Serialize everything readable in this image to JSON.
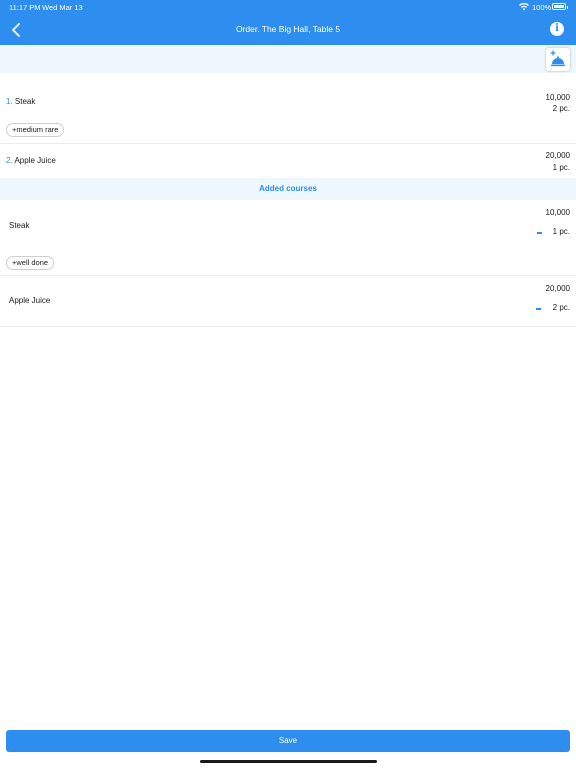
{
  "status_bar": {
    "time": "11:17 PM",
    "date": "Wed Mar 13",
    "battery_percent": "100%"
  },
  "header": {
    "title": "Order. The Big Hall, Table 5",
    "back_icon": "chevron-left-icon",
    "info_icon": "info-icon",
    "info_glyph": "i"
  },
  "toolbar": {
    "add_icon": "add-cloche-icon"
  },
  "order_items": [
    {
      "number": "1.",
      "name": "Steak",
      "price": "10,000",
      "qty": "2 pc.",
      "modifier": "+medium rare"
    },
    {
      "number": "2.",
      "name": "Apple Juice",
      "price": "20,000",
      "qty": "1 pc."
    }
  ],
  "added_section": {
    "title": "Added courses"
  },
  "added_items": [
    {
      "name": "Steak",
      "price": "10,000",
      "qty": "1 pc.",
      "modifier": "+well done"
    },
    {
      "name": "Apple Juice",
      "price": "20,000",
      "qty": "2 pc."
    }
  ],
  "footer": {
    "save_label": "Save"
  },
  "colors": {
    "accent": "#2d8ef0",
    "section_bg": "#eef6fe"
  }
}
